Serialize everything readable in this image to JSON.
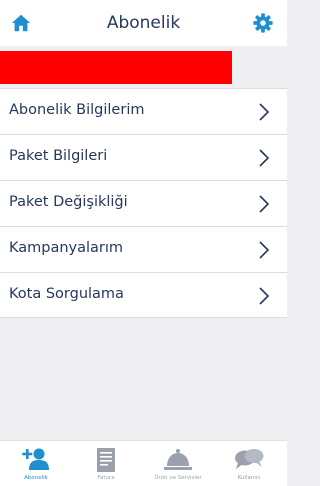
{
  "header": {
    "title": "Abonelik",
    "home_icon": "home-icon",
    "settings_icon": "gear-icon",
    "accent_color": "#1f8fd0"
  },
  "banner": {
    "color": "#ff0000"
  },
  "menu": {
    "items": [
      {
        "label": "Abonelik Bilgilerim"
      },
      {
        "label": "Paket Bilgileri"
      },
      {
        "label": "Paket Değişikliği"
      },
      {
        "label": "Kampanyalarım"
      },
      {
        "label": "Kota Sorgulama"
      }
    ]
  },
  "tabbar": {
    "tabs": [
      {
        "label": "Abonelik",
        "icon": "add-user-icon",
        "active": true
      },
      {
        "label": "Fatura",
        "icon": "invoice-icon",
        "active": false
      },
      {
        "label": "Ürün ve Servisler",
        "icon": "service-bell-icon",
        "active": false
      },
      {
        "label": "Kullanıcı",
        "icon": "chat-bubbles-icon",
        "active": false
      }
    ]
  }
}
